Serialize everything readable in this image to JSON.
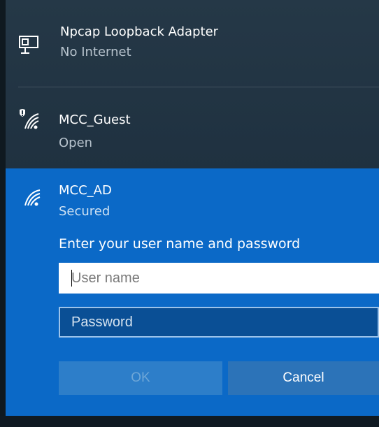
{
  "networks": [
    {
      "name": "Npcap Loopback Adapter",
      "status": "No Internet",
      "icon": "ethernet-adapter-icon"
    },
    {
      "name": "MCC_Guest",
      "status": "Open",
      "icon": "wifi-warning-icon"
    },
    {
      "name": "MCC_AD",
      "status": "Secured",
      "icon": "wifi-icon"
    }
  ],
  "auth": {
    "prompt": "Enter your user name and password",
    "username_placeholder": "User name",
    "password_placeholder": "Password",
    "ok_label": "OK",
    "cancel_label": "Cancel"
  },
  "colors": {
    "selected_bg": "#0b69c7",
    "panel_bg": "#1f3140",
    "ok_disabled_bg": "#2d7ec9",
    "cancel_bg": "#2c73b8"
  }
}
